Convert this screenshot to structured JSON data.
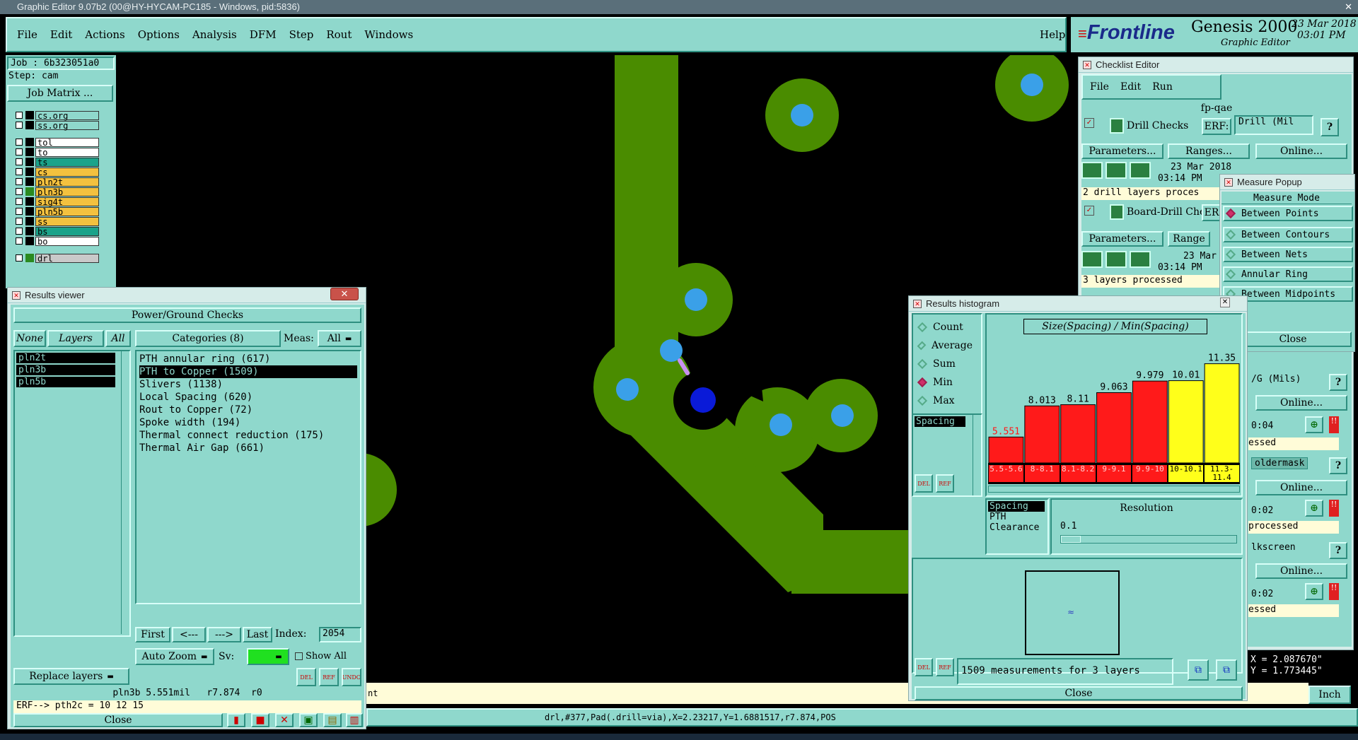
{
  "os_titlebar": {
    "title": "Graphic Editor 9.07b2 (00@HY-HYCAM-PC185 - Windows, pid:5836)"
  },
  "menu": [
    "File",
    "Edit",
    "Actions",
    "Options",
    "Analysis",
    "DFM",
    "Step",
    "Rout",
    "Windows"
  ],
  "help": "Help",
  "brand": {
    "logo": "Frontline",
    "product": "Genesis 2000",
    "subtitle": "Graphic Editor",
    "date": "23 Mar 2018",
    "time": "03:01 PM"
  },
  "job": {
    "job_label": "Job : 6b323051a0",
    "step_label": "Step: cam",
    "matrix_button": "Job Matrix ..."
  },
  "layers": [
    {
      "name": "cs.org",
      "color": "#8fd8cc"
    },
    {
      "name": "ss.org",
      "color": "#8fd8cc"
    },
    {
      "name": "tol",
      "color": "#ffffff"
    },
    {
      "name": "to",
      "color": "#ffffff"
    },
    {
      "name": "ts",
      "color": "#1aa38a"
    },
    {
      "name": "cs",
      "color": "#f3c13f"
    },
    {
      "name": "pln2t",
      "color": "#f3c13f"
    },
    {
      "name": "pln3b",
      "color": "#f3c13f"
    },
    {
      "name": "sig4t",
      "color": "#f3c13f"
    },
    {
      "name": "pln5b",
      "color": "#f3c13f"
    },
    {
      "name": "ss",
      "color": "#f3c13f"
    },
    {
      "name": "bs",
      "color": "#1aa38a"
    },
    {
      "name": "bo",
      "color": "#ffffff"
    },
    {
      "name": "drl",
      "color": "#c9c9c9"
    }
  ],
  "results_viewer": {
    "title": "Results viewer",
    "header": "Power/Ground Checks",
    "tabs": {
      "none": "None",
      "layers": "Layers",
      "all": "All"
    },
    "categories_label": "Categories (8)",
    "meas_label": "Meas:",
    "meas_value": "All",
    "layer_list": [
      "pln2t",
      "pln3b",
      "pln5b"
    ],
    "categories": [
      "PTH annular ring (617)",
      "PTH to Copper (1509)",
      "Slivers (1138)",
      "Local Spacing (620)",
      "Rout to Copper (72)",
      "Spoke width (194)",
      "Thermal connect reduction (175)",
      "Thermal Air Gap (661)"
    ],
    "nav": {
      "first": "First",
      "prev": "<---",
      "next": "--->",
      "last": "Last",
      "index_label": "Index:",
      "index_value": "2054"
    },
    "zoom": "Auto Zoom",
    "sv_label": "Sv:",
    "show_all": "Show All",
    "replace_layers": "Replace layers",
    "icons": {
      "del": "DEL",
      "ref": "REF",
      "undo": "UNDO"
    },
    "info_line": "pln3b 5.551mil   r7.874  r0",
    "erf_line": "ERF--> pth2c = 10 12 15",
    "close": "Close"
  },
  "checklist_editor": {
    "title": "Checklist Editor",
    "menu": [
      "File",
      "Edit",
      "Run"
    ],
    "name": "fp-qae",
    "items": [
      {
        "name": "Drill Checks",
        "erf": "ERF:",
        "erf_value": "Drill (Mil",
        "params": "Parameters...",
        "ranges": "Ranges...",
        "online": "Online...",
        "date": "23 Mar 2018",
        "time": "03:14 PM",
        "status": "2 drill layers proces"
      },
      {
        "name": "Board-Drill Che",
        "erf": "ER",
        "params": "Parameters...",
        "ranges": "Range",
        "date": "23 Mar",
        "time": "03:14 PM",
        "status": "3 layers processed"
      }
    ],
    "right_rows": [
      {
        "text": "/G (Mils)",
        "online": "Online...",
        "time": "0:04",
        "status": "essed"
      },
      {
        "text": "oldermask",
        "online": "Online...",
        "time": "0:02",
        "status": "processed"
      },
      {
        "text": "lkscreen",
        "online": "Online...",
        "time": "0:02",
        "status": "essed"
      }
    ],
    "help": "?"
  },
  "measure_popup": {
    "title": "Measure Popup",
    "mode_label": "Measure Mode",
    "modes": [
      "Between Points",
      "Between Contours",
      "Between Nets",
      "Annular Ring",
      "Between Midpoints"
    ],
    "selected": "Between Points",
    "close": "Close"
  },
  "histogram": {
    "title": "Results histogram",
    "stats": [
      "Count",
      "Average",
      "Sum",
      "Min",
      "Max"
    ],
    "selected_stat": "Min",
    "type_list": [
      "Spacing"
    ],
    "chart_title": "Size(Spacing) / Min(Spacing)",
    "sub_list": [
      "Spacing",
      "PTH",
      "Clearance"
    ],
    "resolution_label": "Resolution",
    "resolution_value": "0.1",
    "summary": "1509 measurements for 3 layers",
    "close": "Close",
    "icons": {
      "del": "DEL",
      "ref": "REF"
    }
  },
  "chart_data": {
    "type": "bar",
    "title": "Size(Spacing) / Min(Spacing)",
    "categories": [
      "5.5-5.6",
      "8-8.1",
      "8.1-8.2",
      "9-9.1",
      "9.9-10",
      "10-10.1",
      "11.3-11.4"
    ],
    "values": [
      5.551,
      8.013,
      8.11,
      9.063,
      9.979,
      10.01,
      11.35
    ],
    "value_labels": [
      "5.551",
      "8.013",
      "8.11",
      "9.063",
      "9.979",
      "10.01",
      "11.35"
    ],
    "colors": [
      "#ff1a1a",
      "#ff1a1a",
      "#ff1a1a",
      "#ff1a1a",
      "#ff1a1a",
      "#ffff1a",
      "#ffff1a"
    ],
    "ylim": [
      0,
      12
    ]
  },
  "coords": {
    "x": "X = 2.087670\"",
    "y": "Y = 1.773445\"",
    "units": "Inch"
  },
  "status_bar": "drl,#377,Pad(.drill=via),X=2.23217,Y=1.6881517,r7.874,POS",
  "cmd_fragment": "nt"
}
